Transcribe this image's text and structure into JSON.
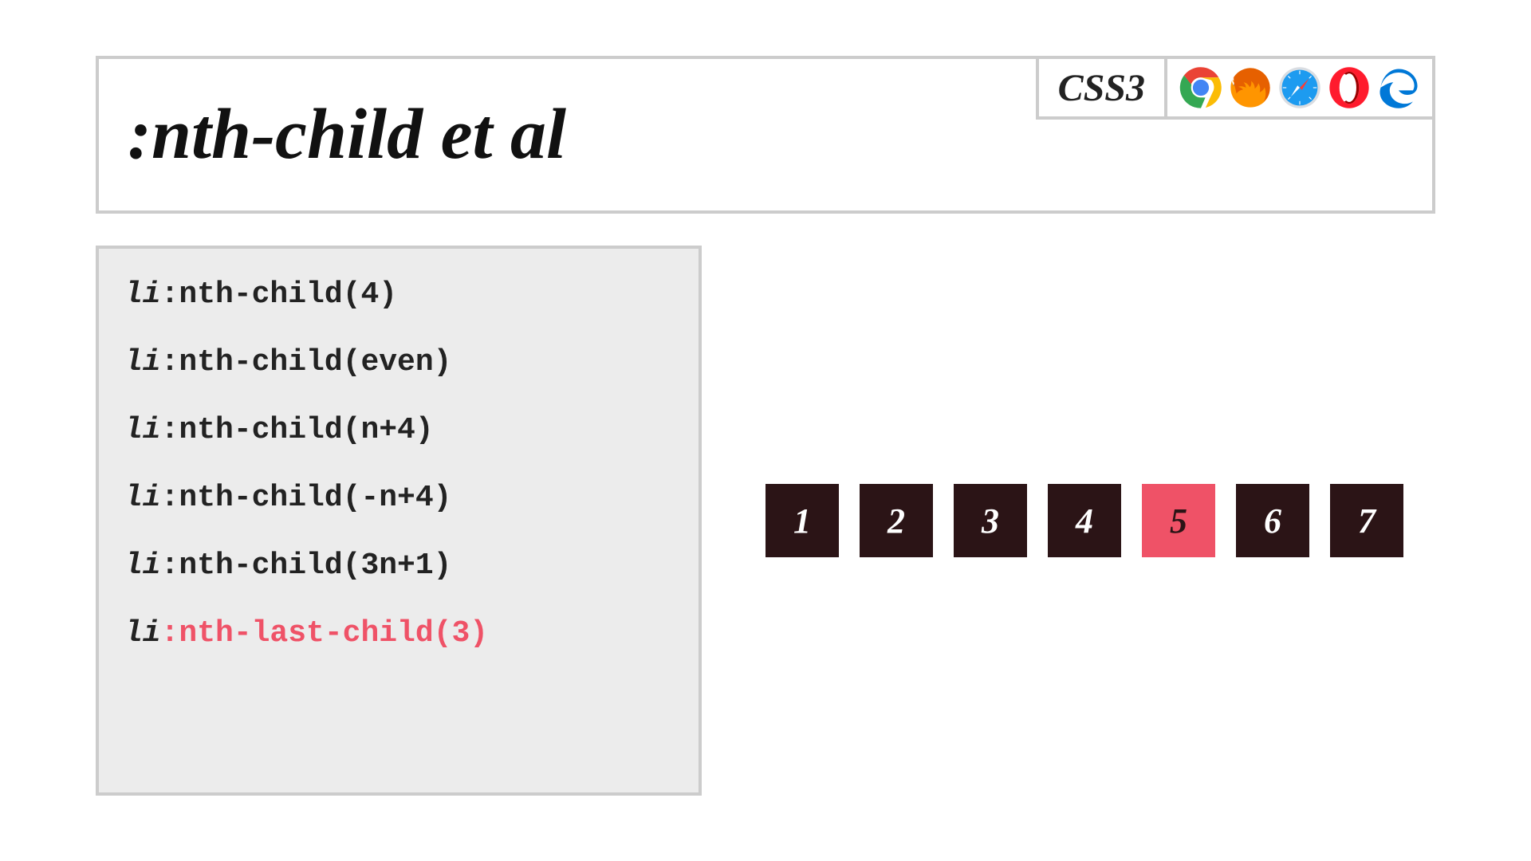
{
  "header": {
    "title": ":nth-child et al",
    "spec_label": "CSS3",
    "browsers": [
      "chrome",
      "firefox",
      "safari",
      "opera",
      "edge"
    ]
  },
  "code": {
    "tag": "li",
    "lines": [
      {
        "selector": ":nth-child(4)",
        "highlight": false
      },
      {
        "selector": ":nth-child(even)",
        "highlight": false
      },
      {
        "selector": ":nth-child(n+4)",
        "highlight": false
      },
      {
        "selector": ":nth-child(-n+4)",
        "highlight": false
      },
      {
        "selector": ":nth-child(3n+1)",
        "highlight": false
      },
      {
        "selector": ":nth-last-child(3)",
        "highlight": true
      }
    ]
  },
  "demo": {
    "items": [
      {
        "label": "1",
        "highlight": false
      },
      {
        "label": "2",
        "highlight": false
      },
      {
        "label": "3",
        "highlight": false
      },
      {
        "label": "4",
        "highlight": false
      },
      {
        "label": "5",
        "highlight": true
      },
      {
        "label": "6",
        "highlight": false
      },
      {
        "label": "7",
        "highlight": false
      }
    ]
  },
  "colors": {
    "highlight": "#ef5267",
    "box_dark": "#2b1416",
    "border": "#cccccc",
    "panel_bg": "#ececec"
  }
}
